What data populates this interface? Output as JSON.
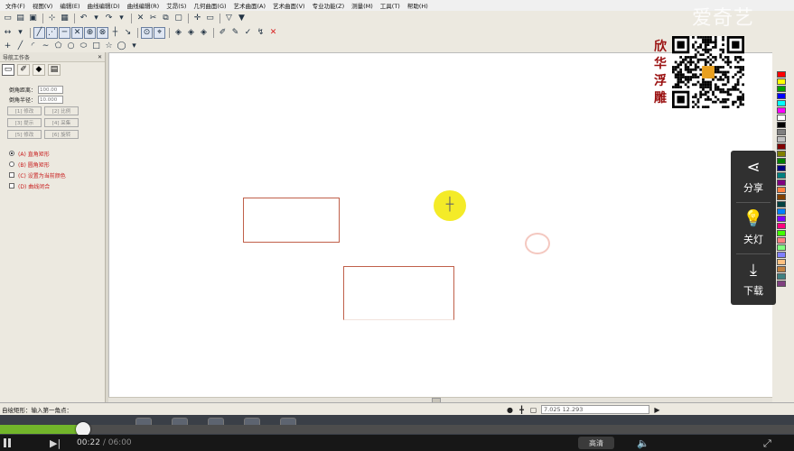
{
  "menubar": {
    "items": [
      "文件(F)",
      "视图(V)",
      "编辑(E)",
      "曲线编辑(D)",
      "曲线编辑(R)",
      "艾昂(S)",
      "几何曲面(G)",
      "艺术曲面(A)",
      "艺术曲面(V)",
      "专业功能(Z)",
      "测量(M)",
      "工具(T)",
      "帮助(H)"
    ]
  },
  "toolbar": {
    "row1_icons": [
      "new-icon",
      "open-icon",
      "save-icon",
      "snap-icon",
      "image-icon",
      "undo-icon",
      "redo-icon",
      "delete-icon",
      "cut-icon",
      "copy-icon",
      "paste-icon",
      "align-icon",
      "layer-icon",
      "filter-icon",
      "view-icon"
    ],
    "row2_icons": [
      "line-icon",
      "polyline-icon",
      "arc-icon",
      "cross-icon",
      "circle-plus-icon",
      "circle-x-icon",
      "trim-icon",
      "extend-icon",
      "select-icon",
      "node-icon",
      "layer1-icon",
      "layer2-icon",
      "layer3-icon",
      "tool1-icon",
      "tool2-icon",
      "tool3-icon",
      "tool4-icon",
      "close-x-icon"
    ],
    "row3_icons": [
      "point-icon",
      "line-icon",
      "arc-icon",
      "curve-icon",
      "polygon-icon",
      "circle-icon",
      "ellipse-icon",
      "rectangle-icon",
      "star-icon",
      "cycle-icon"
    ]
  },
  "left_panel": {
    "title": "导航工作条",
    "tabs": [
      "rect-tab-icon",
      "tool-tab-icon",
      "color-tab-icon",
      "layer-tab-icon"
    ],
    "fields": [
      {
        "label": "倒角距离：",
        "value": "100.00"
      },
      {
        "label": "倒角半径：",
        "value": "10.000"
      }
    ],
    "buttons": [
      [
        "[1] 修改",
        "[2] 比例"
      ],
      [
        "[3] 提示",
        "[4] 采集"
      ],
      [
        "[5] 修改",
        "[6] 旋转"
      ]
    ],
    "options": [
      {
        "type": "radio",
        "checked": true,
        "label": "(A) 直角矩形"
      },
      {
        "type": "radio",
        "checked": false,
        "label": "(B) 圆角矩形"
      },
      {
        "type": "check",
        "checked": false,
        "label": "(C) 设置为当前颜色"
      },
      {
        "type": "check",
        "checked": false,
        "label": "(D) 曲线闭合"
      }
    ]
  },
  "canvas": {
    "shapes": [
      "rectangle-1",
      "rectangle-2"
    ]
  },
  "palette_colors": [
    "#ff0000",
    "#ffff00",
    "#00a000",
    "#0000ff",
    "#00ffff",
    "#ff00ff",
    "#ffffff",
    "#000000",
    "#808080",
    "#c0c0c0",
    "#800000",
    "#808000",
    "#008000",
    "#000080",
    "#008080",
    "#800080",
    "#ff8040",
    "#804000",
    "#004040",
    "#0080ff",
    "#8000ff",
    "#ff0080",
    "#40ff00",
    "#ff8080",
    "#80ff80",
    "#8080ff",
    "#ffc080",
    "#c08040",
    "#408080",
    "#804080"
  ],
  "status": {
    "prompt": "自绘矩形：输入第一角点：",
    "coords": "7.025  12.293"
  },
  "overlay": {
    "watermark": "爱奇艺",
    "logo_chars": [
      "欣",
      "华",
      "浮",
      "雕"
    ],
    "share_label": "分享",
    "lights_label": "关灯",
    "download_label": "下载"
  },
  "player": {
    "progress": 0.105,
    "time_current": "00:22",
    "time_total": "06:00",
    "quality": "高清"
  }
}
